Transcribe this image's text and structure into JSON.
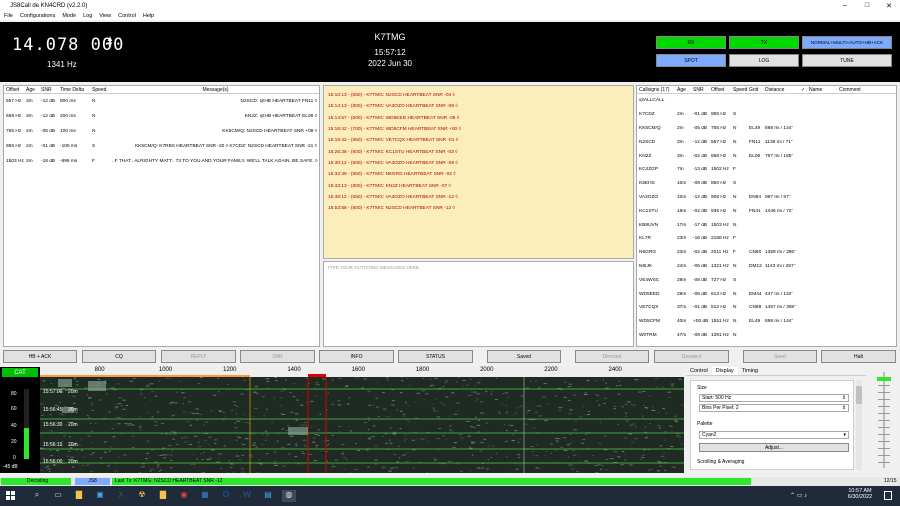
{
  "window": {
    "title": "JS8Call de KN4CRD (v2.2.0)",
    "min": "–",
    "max": "□",
    "close": "✕"
  },
  "menu": [
    "File",
    "Configurations",
    "Mode",
    "Log",
    "View",
    "Control",
    "Help"
  ],
  "top": {
    "freq": "14.078 000",
    "dial_offset": "1341 Hz",
    "callsign": "K7TMG",
    "clock": "15:57:12",
    "date": "2022 Jun 30"
  },
  "top_buttons": {
    "rx": "RX",
    "tx": "TX",
    "mode": "NORMAL+MULTI+AUTO+HB+ACK",
    "spot": "SPOT",
    "log": "LOG",
    "tune": "TUNE"
  },
  "colors": {
    "green_btn": "#00d800",
    "blue_btn": "#7da9ff",
    "waterfall": "#1e2a22",
    "cat": "#00c000"
  },
  "activity": {
    "headers": [
      "Offset",
      "Age",
      "SNR",
      "Time Delta",
      "Speed",
      "Message(s)"
    ],
    "rows": [
      [
        "557 Hz",
        "3m",
        "-12 dB",
        "800 ms",
        "N",
        "N2SCD: @HB HEARTBEAT FN11 ◊"
      ],
      [
        "658 Hz",
        "3m",
        "-12 dB",
        "200 ms",
        "N",
        "KN2Z: @HB HEARTBEAT EL06 ◊"
      ],
      [
        "765 Hz",
        "2m",
        "-05 dB",
        "100 ms",
        "N",
        "KK5CM/Q: N2SCD HEARTBEAT SNR +09 ◊"
      ],
      [
        "955 Hz",
        "2m",
        "-01 dB",
        "-100 ms",
        "S",
        "KK5CM/Q: K7RBS HEARTBEAT SNR -20 ◊ K7CDZ: N2SCD HEARTBEAT SNR -21 ◊"
      ],
      [
        "1503 Hz",
        "2m",
        "-18 dB",
        "-699 ms",
        "F",
        "..F THAT.. ALRIGHTY MATT.. 73 TO YOU AND YOUR FAMILY. WE'LL TALK AGAIN. BE SAFE. ◊"
      ]
    ]
  },
  "rx_log": [
    "15:10:13 - (650) - K7TMG: N2SCD HEARTBEAT SNR -04 ◊",
    "15:14:13 - (800) - K7TMG: VA3OZO HEARTBEAT SNR -08 ◊",
    "15:14:57 - (600) - K7TMG: WD5EED HEARTBEAT SNR -05 ◊",
    "15:16:42 - (700) - K7TMG: WD5CFM HEARTBEAT SNR +00 ◊",
    "15:16:42 - (950) - K7TMG: VE7CQX HEARTBEAT SNR -01 ◊",
    "15:26:38 - (600) - K7TMG: KC1STU HEARTBEAT SNR -03 ◊",
    "15:30:12 - (600) - K7TMG: VA3OZO HEARTBEAT SNR -09 ◊",
    "15:32:39 - (950) - K7TMG: N6GRG HEARTBEAT SNR -02 ◊",
    "15:43:13 - (800) - K7TMG: KN2Z HEARTBEAT SNR -07 ◊",
    "15:46:12 - (650) - K7TMG: VA3OZO HEARTBEAT SNR -12 ◊",
    "15:53:58 - (800) - K7TMG: N2SCD HEARTBEAT SNR -12 ◊"
  ],
  "outgoing_placeholder": "TYPE YOUR OUTGOING MESSAGES HERE.",
  "calls": {
    "headers": [
      "Callsigns (17)",
      "Age",
      "SNR",
      "Offset",
      "Speed",
      "Grid",
      "Distance",
      "✓",
      "Name",
      "Comment"
    ],
    "rows": [
      [
        "@ALLCALL",
        "",
        "",
        "",
        "",
        "",
        "",
        "",
        "",
        ""
      ],
      [
        "K7CDZ",
        "2m",
        "-01 dB",
        "955 Hz",
        "S",
        "",
        "",
        "",
        "",
        ""
      ],
      [
        "KK5CM/Q",
        "2m",
        "-05 dB",
        "765 Hz",
        "N",
        "EL49",
        "698 mi / 144°",
        "",
        "",
        ""
      ],
      [
        "N2SCD",
        "3m",
        "-12 dB",
        "557 Hz",
        "N",
        "FN11",
        "1135 mi / 71°",
        "",
        "",
        ""
      ],
      [
        "KN2Z",
        "3m",
        "-02 dB",
        "658 Hz",
        "N",
        "EL06",
        "767 mi / 185°",
        "",
        "",
        ""
      ],
      [
        "KC4ZGP",
        "7m",
        "-13 dB",
        "1502 Hz",
        "F",
        "",
        "",
        "",
        "",
        ""
      ],
      [
        "K5EHS",
        "10m",
        "-08 dB",
        "850 Hz",
        "S",
        "",
        "",
        "",
        "",
        ""
      ],
      [
        "VA3OZO",
        "10m",
        "-12 dB",
        "908 Hz",
        "N",
        "EN84",
        "987 mi / 57°",
        "",
        "",
        ""
      ],
      [
        "KC1STU",
        "16m",
        "-02 dB",
        "935 Hz",
        "N",
        "FN41",
        "1446 mi / 72°",
        "",
        "",
        ""
      ],
      [
        "KB8UVN",
        "17m",
        "-17 dB",
        "1503 Hz",
        "N",
        "",
        "",
        "",
        "",
        ""
      ],
      [
        "KL7R",
        "23m",
        "-16 dB",
        "2168 Hz",
        "F",
        "",
        "",
        "",
        "",
        ""
      ],
      [
        "N6GRG",
        "23m",
        "-02 dB",
        "2011 Hz",
        "F",
        "CN80",
        "1358 mi / 286°",
        "",
        "",
        ""
      ],
      [
        "N6IJK",
        "24m",
        "-06 dB",
        "1321 Hz",
        "N",
        "DM12",
        "1143 mi / 257°",
        "",
        "",
        ""
      ],
      [
        "VE4WSC",
        "28m",
        "-08 dB",
        "727 Hz",
        "S",
        "",
        "",
        "",
        "",
        ""
      ],
      [
        "WD5EED",
        "29m",
        "-08 dB",
        "613 Hz",
        "N",
        "EM44",
        "447 mi / 119°",
        "",
        "",
        ""
      ],
      [
        "VE7CQX",
        "37m",
        "-01 dB",
        "512 Hz",
        "N",
        "CN88",
        "1457 mi / 308°",
        "",
        "",
        ""
      ],
      [
        "WD5CFM",
        "40m",
        "+00 dB",
        "1551 Hz",
        "N",
        "EL49",
        "698 mi / 144°",
        "",
        "",
        ""
      ],
      [
        "W0TRM",
        "47m",
        "-08 dB",
        "1391 Hz",
        "N",
        "",
        "",
        "",
        "",
        ""
      ]
    ]
  },
  "action_buttons": [
    "HB + ACK",
    "CQ",
    "REPLY",
    "SNR",
    "INFO",
    "STATUS",
    "Saved",
    "Directed",
    "Deselect",
    "Send",
    "Halt"
  ],
  "ruler_ticks": [
    "800",
    "1000",
    "1200",
    "1400",
    "1600",
    "1800",
    "2000",
    "2200",
    "2400"
  ],
  "waterfall_labels": [
    "15:57:00",
    "15:56:45",
    "15:56:30",
    "15:56:15",
    "15:56:00"
  ],
  "waterfall_tags": [
    "20m",
    "20m",
    "20m",
    "20m",
    "20m"
  ],
  "meter": {
    "label": "CAT",
    "scale": [
      "80",
      "60",
      "40",
      "20",
      "0"
    ],
    "unit": "-45 dB",
    "level": 0.45
  },
  "side_tabs": [
    "Control",
    "Display",
    "Timing"
  ],
  "side_panel": {
    "size_label": "Size",
    "start": "Start: 500 Hz",
    "bins": "Bins Per Pixel: 2",
    "palette_label": "Palette",
    "palette": "Cyan2",
    "adjust": "Adjust...",
    "scroll": "Scrolling & Averaging"
  },
  "status": {
    "decoding": "Decoding",
    "js8": "JS8",
    "last_tx": "Last Tx: K7TMG: N2SCD HEARTBEAT SNR -12",
    "count": "12/15"
  },
  "taskbar": {
    "time": "10:57 AM",
    "date": "6/30/2022"
  }
}
